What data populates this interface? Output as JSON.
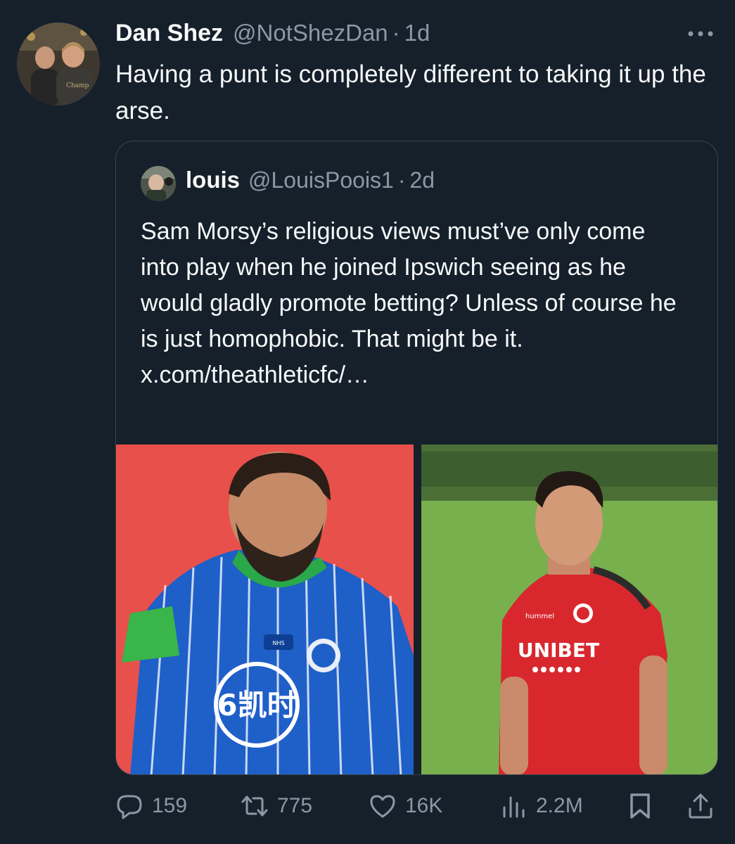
{
  "tweet": {
    "author_name": "Dan Shez",
    "author_handle": "@NotShezDan",
    "separator": "·",
    "time": "1d",
    "text": "Having a punt is completely different to taking it up the arse."
  },
  "quoted_tweet": {
    "author_name": "louis",
    "author_handle": "@LouisPoois1",
    "separator": "·",
    "time": "2d",
    "text": "Sam Morsy’s religious views must’ve only come into play when he joined Ipswich seeing as he would gladly promote betting? Unless of course he is just homophobic. That might be it. x.com/theathleticfc/…",
    "images": [
      {
        "description_icon": "photo-player-blue-kit",
        "kit_sponsor": "凯时",
        "badge_text": "NHS THANK YOU"
      },
      {
        "description_icon": "photo-player-red-kit",
        "kit_sponsor": "UNIBET",
        "brand": "hummel"
      }
    ]
  },
  "actions": {
    "replies": "159",
    "retweets": "775",
    "likes": "16K",
    "views": "2.2M"
  },
  "colors": {
    "background": "#15202b",
    "text_primary": "#f7f9f9",
    "text_secondary": "#8b98a5",
    "border": "#38444d"
  },
  "icons": [
    "more-icon",
    "reply-icon",
    "retweet-icon",
    "like-icon",
    "views-icon",
    "bookmark-icon",
    "share-icon"
  ]
}
